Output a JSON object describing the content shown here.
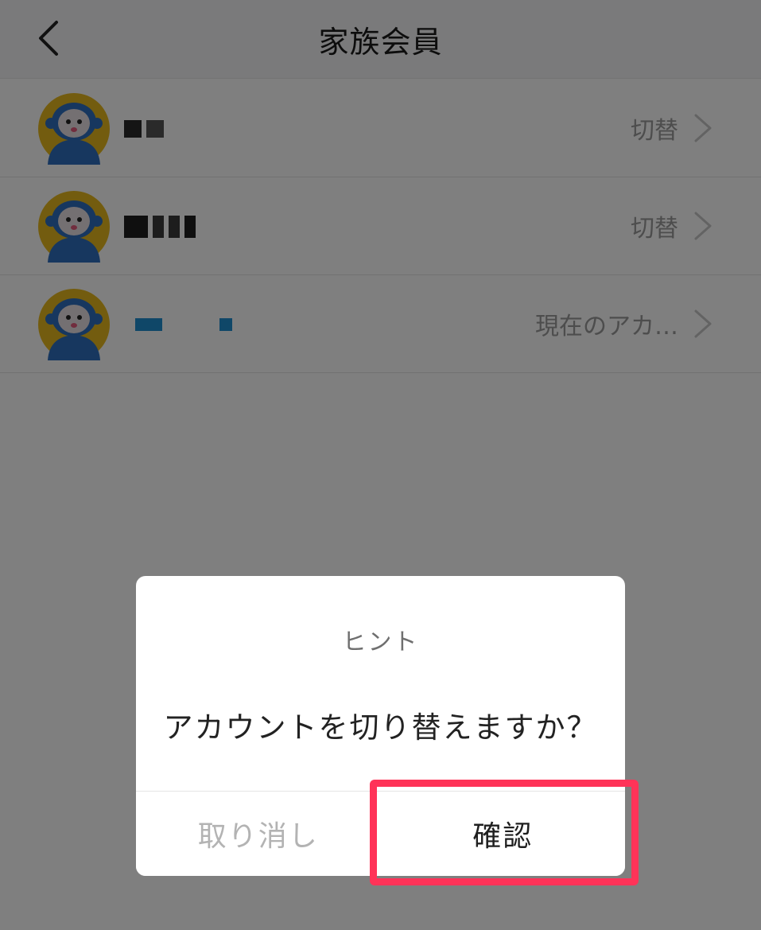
{
  "header": {
    "title": "家族会員"
  },
  "members": [
    {
      "action_label": "切替",
      "name_colors": [
        "#2a2a2a",
        "#555555"
      ]
    },
    {
      "action_label": "切替",
      "name_colors": [
        "#1e1e1e",
        "#3a3a3a"
      ]
    },
    {
      "action_label": "現在のアカ…",
      "name_colors": [
        "#1e8fd0",
        "#1e8fd0"
      ]
    }
  ],
  "dialog": {
    "title": "ヒント",
    "message": "アカウントを切り替えますか？",
    "cancel_label": "取り消し",
    "confirm_label": "確認"
  },
  "colors": {
    "highlight": "#ff3358",
    "avatar_bg": "#e6b81e",
    "avatar_figure": "#2f6fbf"
  }
}
